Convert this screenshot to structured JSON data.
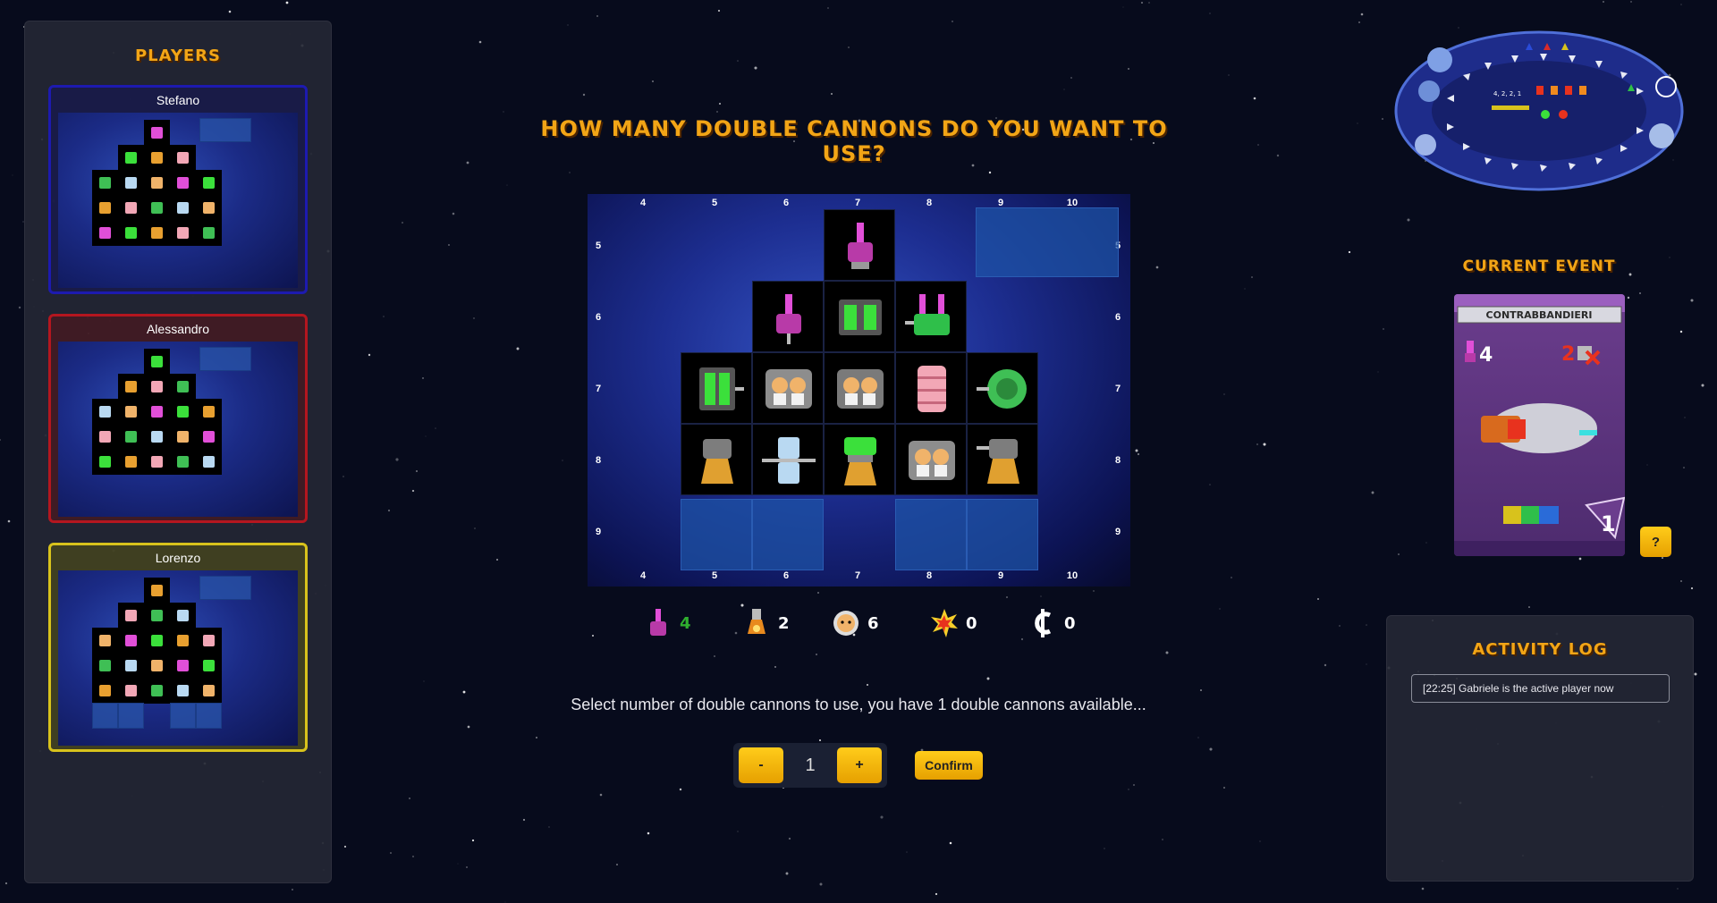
{
  "players_panel": {
    "title": "Players",
    "players": [
      {
        "name": "Stefano",
        "color": "#1d1ab0"
      },
      {
        "name": "Alessandro",
        "color": "#b4161f"
      },
      {
        "name": "Lorenzo",
        "color": "#d8c21c"
      }
    ]
  },
  "question": "How many double cannons do you want to use?",
  "board": {
    "columns": [
      "4",
      "5",
      "6",
      "7",
      "8",
      "9",
      "10"
    ],
    "rows": [
      "5",
      "6",
      "7",
      "8",
      "9"
    ]
  },
  "stats": {
    "cannons": {
      "icon": "cannon-icon",
      "value": "4",
      "color": "#2fae2f"
    },
    "engines": {
      "icon": "engine-icon",
      "value": "2"
    },
    "crew": {
      "icon": "astronaut-icon",
      "value": "6"
    },
    "exposed_connectors": {
      "icon": "explosion-icon",
      "value": "0"
    },
    "credits": {
      "icon": "credit-icon",
      "value": "0"
    }
  },
  "instruction": "Select number of double cannons to use, you have 1 double cannons available...",
  "stepper": {
    "minus_label": "-",
    "value": "1",
    "plus_label": "+"
  },
  "confirm_label": "Confirm",
  "current_event": {
    "title": "Current Event",
    "card_name": "CONTRABBANDIERI",
    "firepower": "4",
    "penalty": "2",
    "flight_days": "1",
    "help_label": "?"
  },
  "activity_log": {
    "title": "Activity Log",
    "entries": [
      "[22:25] Gabriele is the active player now"
    ]
  },
  "flight_board": {
    "summary_text": "4, 2, 2, 1"
  }
}
